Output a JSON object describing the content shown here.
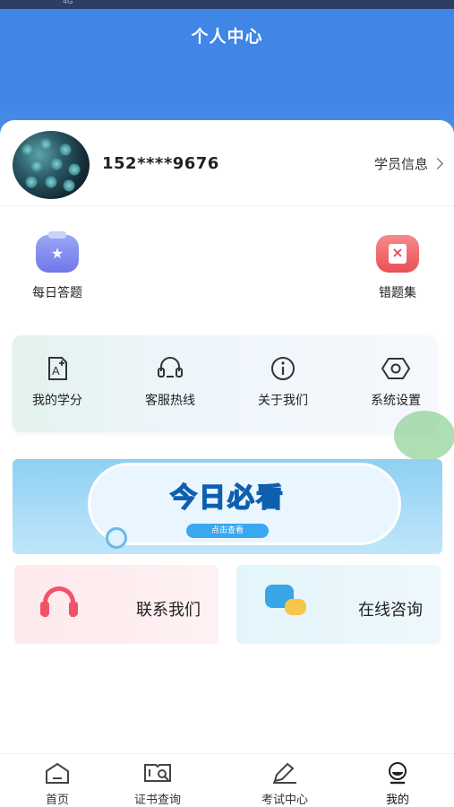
{
  "status_bar": {
    "text": "4G"
  },
  "header": {
    "title": "个人中心"
  },
  "profile": {
    "phone": "152****9676",
    "student_info_label": "学员信息"
  },
  "quick_actions": [
    {
      "label": "每日答题",
      "icon": "medal-icon"
    },
    {
      "label": "错题集",
      "icon": "wrong-book-icon"
    }
  ],
  "tools": [
    {
      "label": "我的学分",
      "icon": "credit-icon"
    },
    {
      "label": "客服热线",
      "icon": "headset-icon"
    },
    {
      "label": "关于我们",
      "icon": "info-icon"
    },
    {
      "label": "系统设置",
      "icon": "settings-icon"
    }
  ],
  "banner": {
    "headline": "今日必看",
    "button": "点击查看"
  },
  "contacts": [
    {
      "label": "联系我们",
      "icon": "headset-icon"
    },
    {
      "label": "在线咨询",
      "icon": "chat-icon"
    }
  ],
  "tabbar": {
    "active": "我的",
    "items": [
      {
        "label": "首页",
        "icon": "home-icon"
      },
      {
        "label": "证书查询",
        "icon": "certificate-search-icon"
      },
      {
        "label": "考试中心",
        "icon": "pencil-icon"
      },
      {
        "label": "我的",
        "icon": "profile-icon"
      }
    ]
  },
  "colors": {
    "primary": "#3f86e6",
    "accent_red": "#ea4f55",
    "accent_purple": "#6f78e8"
  }
}
